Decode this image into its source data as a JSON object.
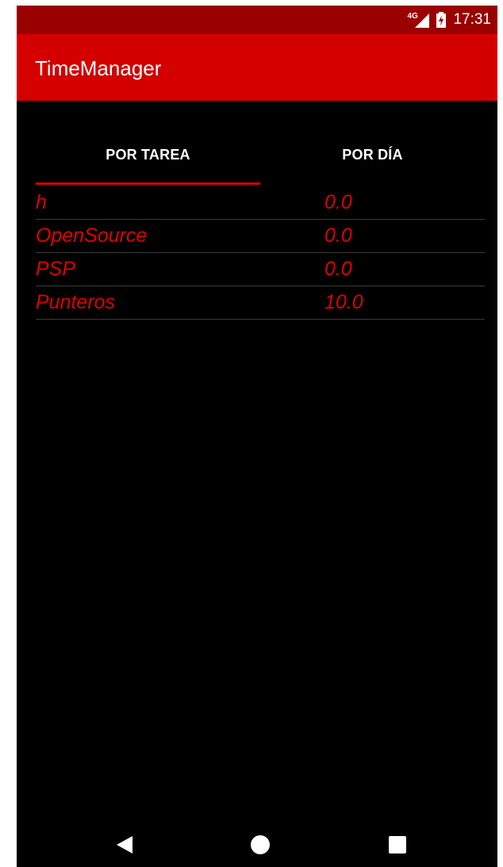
{
  "status_bar": {
    "network_type": "4G",
    "time": "17:31",
    "icons": [
      "signal-icon",
      "battery-charging-icon"
    ]
  },
  "app_bar": {
    "title": "TimeManager"
  },
  "tabs": [
    {
      "label": "POR TAREA",
      "selected": true
    },
    {
      "label": "POR DÍA",
      "selected": false
    }
  ],
  "tasks": [
    {
      "name": "h",
      "value": "0.0"
    },
    {
      "name": "OpenSource",
      "value": "0.0"
    },
    {
      "name": "PSP",
      "value": "0.0"
    },
    {
      "name": "Punteros",
      "value": "10.0"
    }
  ],
  "navigation": {
    "icons": [
      "back-icon",
      "home-icon",
      "recents-icon"
    ]
  },
  "colors": {
    "status_bar": "#9b0000",
    "app_bar": "#d40000",
    "accent": "#d40000",
    "list_text": "#e00000",
    "background": "#000000"
  }
}
